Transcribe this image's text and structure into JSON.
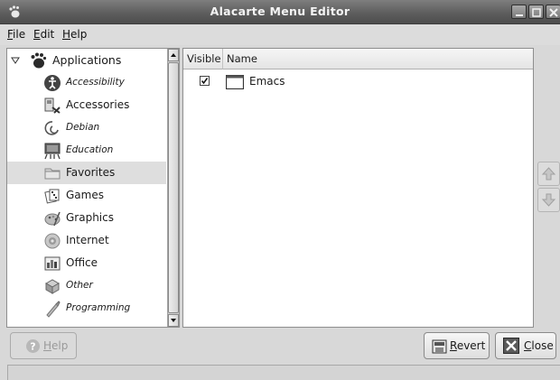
{
  "window": {
    "title": "Alacarte Menu Editor"
  },
  "menubar": {
    "file": {
      "mnemonic": "F",
      "rest": "ile"
    },
    "edit": {
      "mnemonic": "E",
      "rest": "dit"
    },
    "help": {
      "mnemonic": "H",
      "rest": "elp"
    }
  },
  "tree": {
    "root_label": "Applications",
    "items": [
      {
        "label": "Accessibility",
        "icon": "accessibility-icon"
      },
      {
        "label": "Accessories",
        "icon": "accessories-icon"
      },
      {
        "label": "Debian",
        "icon": "debian-icon"
      },
      {
        "label": "Education",
        "icon": "education-icon"
      },
      {
        "label": "Favorites",
        "icon": "folder-icon",
        "selected": true
      },
      {
        "label": "Games",
        "icon": "games-icon"
      },
      {
        "label": "Graphics",
        "icon": "graphics-icon"
      },
      {
        "label": "Internet",
        "icon": "internet-icon"
      },
      {
        "label": "Office",
        "icon": "office-icon"
      },
      {
        "label": "Other",
        "icon": "other-icon"
      },
      {
        "label": "Programming",
        "icon": "programming-icon"
      }
    ]
  },
  "items_list": {
    "headers": {
      "visible": "Visible",
      "name": "Name"
    },
    "rows": [
      {
        "visible": true,
        "name": "Emacs",
        "icon": "window-icon"
      }
    ]
  },
  "buttons": {
    "help": {
      "mnemonic": "H",
      "rest": "elp"
    },
    "revert": {
      "mnemonic": "R",
      "rest": "evert"
    },
    "close": {
      "mnemonic": "C",
      "rest": "lose"
    }
  },
  "colors": {
    "titlebar": "#5e5e5e",
    "selected_row": "#dedede"
  }
}
